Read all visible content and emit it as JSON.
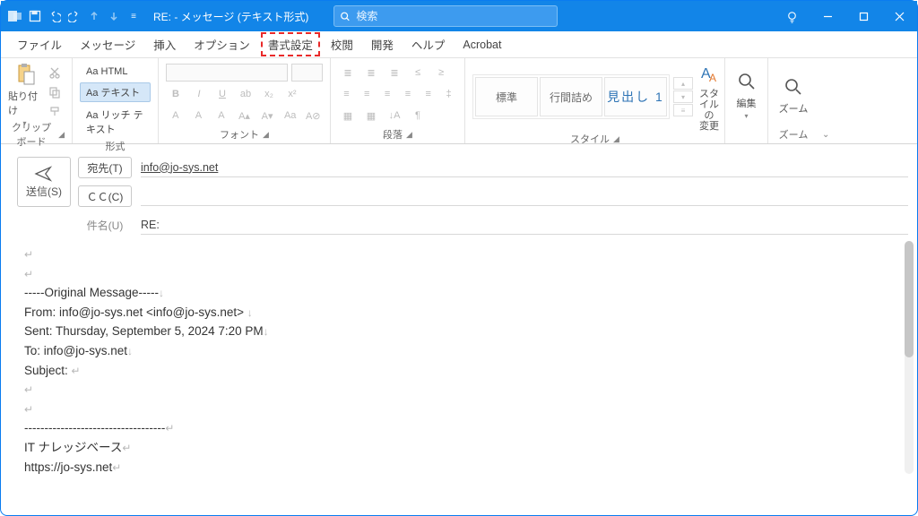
{
  "title": "RE:  - メッセージ (テキスト形式)",
  "search": {
    "placeholder": "検索"
  },
  "menu": {
    "file": "ファイル",
    "message": "メッセージ",
    "insert": "挿入",
    "option": "オプション",
    "format": "書式設定",
    "review": "校閲",
    "dev": "開発",
    "help": "ヘルプ",
    "acrobat": "Acrobat"
  },
  "ribbon": {
    "clipboard": {
      "paste": "貼り付け",
      "label": "クリップボード"
    },
    "format": {
      "html": "Aa HTML",
      "text": "Aa テキスト",
      "rich": "Aa リッチ テキスト",
      "label": "形式"
    },
    "font": {
      "label": "フォント"
    },
    "para": {
      "label": "段落"
    },
    "styles": {
      "normal": "標準",
      "nospace": "行間詰め",
      "heading1": "見出し 1",
      "change": "スタイルの\n変更",
      "label": "スタイル"
    },
    "editing": {
      "edit": "編集",
      "label": ""
    },
    "zoom": {
      "zoom": "ズーム",
      "label": "ズーム"
    }
  },
  "compose": {
    "send": "送信(S)",
    "to_btn": "宛先(T)",
    "to_value": "info@jo-sys.net",
    "cc_btn": "ＣＣ(C)",
    "cc_value": "",
    "subject_label": "件名(U)",
    "subject_value": "RE:"
  },
  "body": {
    "l1": "-----Original Message-----",
    "l2": "From: info@jo-sys.net <info@jo-sys.net>",
    "l3": "Sent: Thursday, September 5, 2024 7:20 PM",
    "l4": "To: info@jo-sys.net",
    "l5": "Subject: ",
    "l6": "-----------------------------------",
    "l7": "IT ナレッジベース",
    "l8": "https://jo-sys.net"
  }
}
